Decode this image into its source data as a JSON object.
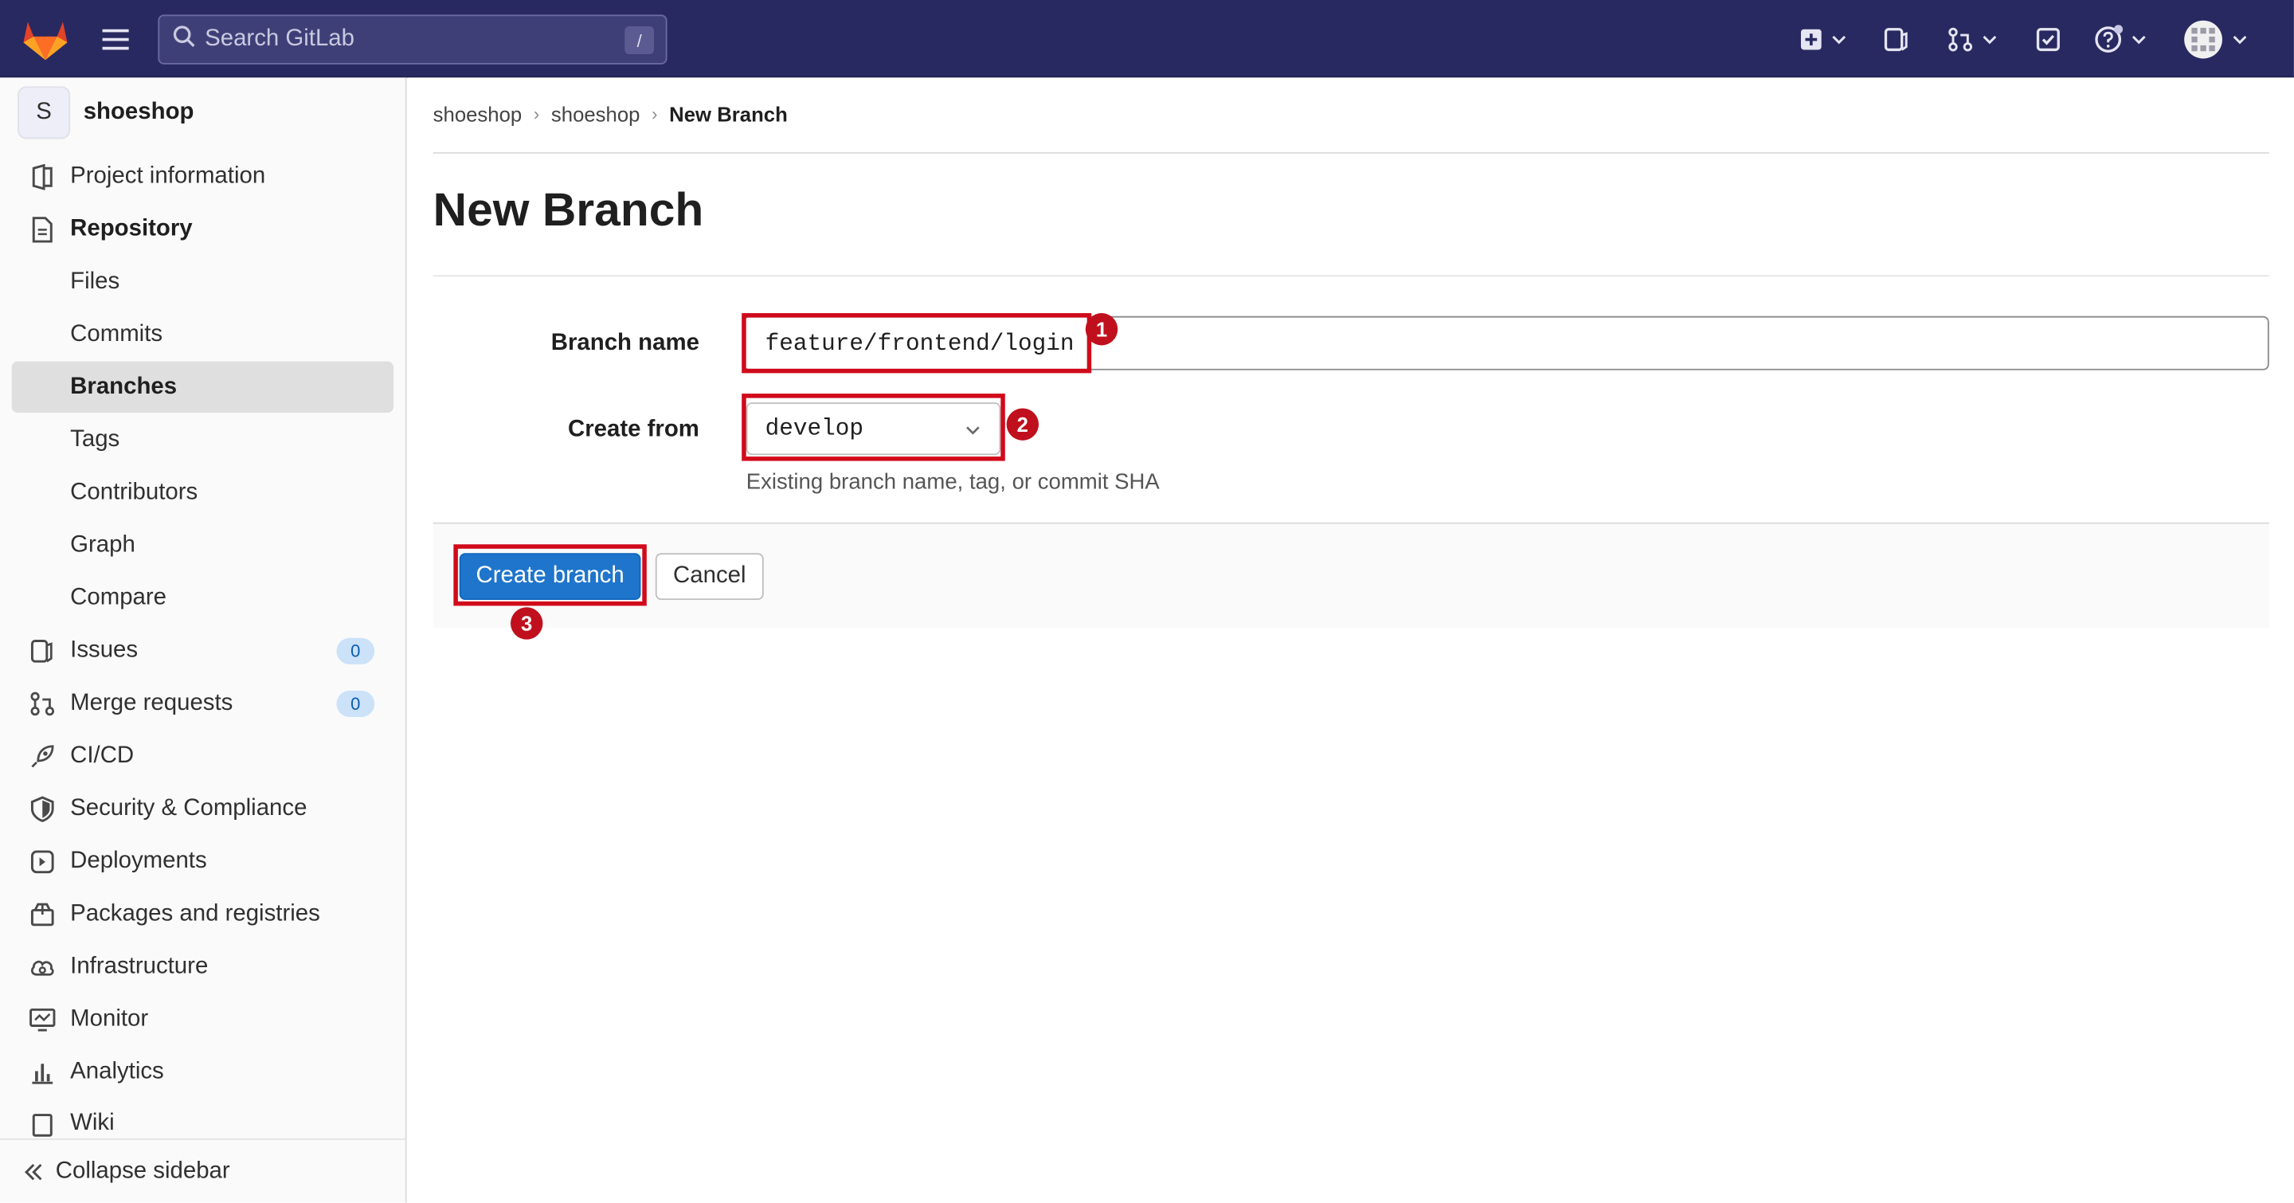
{
  "header": {
    "search_placeholder": "Search GitLab",
    "search_shortcut": "/"
  },
  "sidebar": {
    "project_initial": "S",
    "project_name": "shoeshop",
    "items": [
      {
        "label": "Project information",
        "icon": "project-info-icon"
      },
      {
        "label": "Repository",
        "icon": "document-icon"
      },
      {
        "label": "Files"
      },
      {
        "label": "Commits"
      },
      {
        "label": "Branches",
        "active": true
      },
      {
        "label": "Tags"
      },
      {
        "label": "Contributors"
      },
      {
        "label": "Graph"
      },
      {
        "label": "Compare"
      },
      {
        "label": "Issues",
        "icon": "issues-icon",
        "count": "0"
      },
      {
        "label": "Merge requests",
        "icon": "merge-request-icon",
        "count": "0"
      },
      {
        "label": "CI/CD",
        "icon": "rocket-icon"
      },
      {
        "label": "Security & Compliance",
        "icon": "shield-icon"
      },
      {
        "label": "Deployments",
        "icon": "deployments-icon"
      },
      {
        "label": "Packages and registries",
        "icon": "package-icon"
      },
      {
        "label": "Infrastructure",
        "icon": "cloud-gear-icon"
      },
      {
        "label": "Monitor",
        "icon": "monitor-icon"
      },
      {
        "label": "Analytics",
        "icon": "chart-icon"
      },
      {
        "label": "Wiki",
        "icon": "book-icon"
      }
    ],
    "collapse_label": "Collapse sidebar"
  },
  "breadcrumbs": [
    "shoeshop",
    "shoeshop",
    "New Branch"
  ],
  "page_title": "New Branch",
  "form": {
    "branch_name_label": "Branch name",
    "branch_name_value": "feature/frontend/login",
    "create_from_label": "Create from",
    "create_from_value": "develop",
    "help_text": "Existing branch name, tag, or commit SHA",
    "create_button": "Create branch",
    "cancel_button": "Cancel"
  },
  "annotations": [
    "1",
    "2",
    "3"
  ],
  "colors": {
    "navbar": "#292961",
    "primary": "#1f75cb",
    "annotation": "#d10a1b"
  }
}
